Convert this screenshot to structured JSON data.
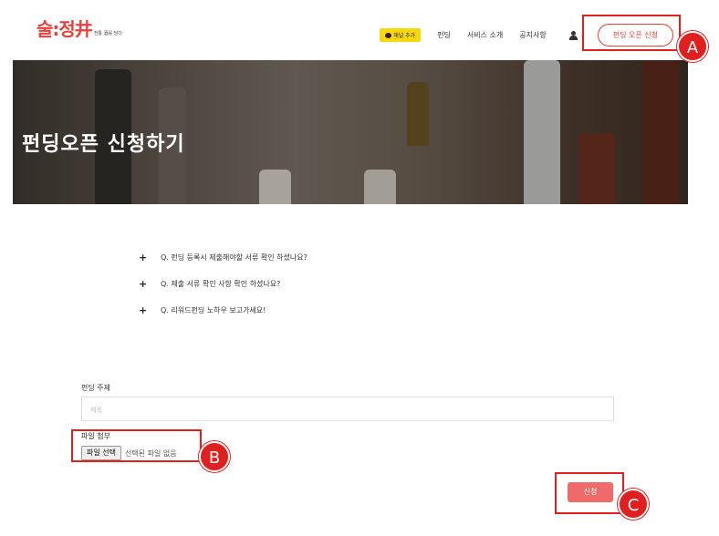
{
  "header": {
    "logo_main": "술:정井",
    "logo_sub": "전통 酒를 담다",
    "kakao_label": "채널 추가",
    "nav": [
      "펀딩",
      "서비스 소개",
      "공지사항"
    ],
    "open_button": "펀딩 오픈 신청",
    "user_icon": "user-icon"
  },
  "hero": {
    "title": "펀딩오픈 신청하기"
  },
  "faq": [
    "Q. 펀딩 등록시 제출해야할 서류 확인 하셨나요?",
    "Q. 제출 서류 확인 사항 확인 하셨나요?",
    "Q. 리워드펀딩 노하우 보고가세요!"
  ],
  "form": {
    "subject_label": "펀딩 주제",
    "subject_placeholder": "제목",
    "file_label": "파일 첨부",
    "file_button": "파일 선택",
    "file_none": "선택된 파일 없음",
    "submit": "신청"
  },
  "annotations": {
    "a": "A",
    "b": "B",
    "c": "C"
  },
  "colors": {
    "brand": "#e8413c",
    "kakao": "#f5d90a",
    "submit": "#ef6b6b",
    "annotation": "#e02020"
  }
}
